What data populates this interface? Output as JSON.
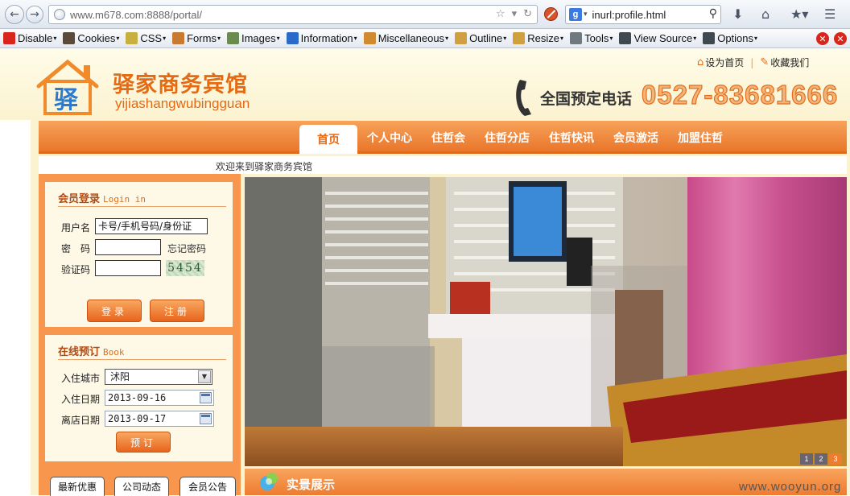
{
  "browser": {
    "url": "www.m678.com:8888/portal/",
    "search_engine_letter": "g",
    "search_query": "inurl:profile.html"
  },
  "devbar": {
    "items": [
      {
        "label": "Disable",
        "icon": "disable-icon",
        "color": "#d9261c"
      },
      {
        "label": "Cookies",
        "icon": "cookies-icon",
        "color": "#5a4a3a"
      },
      {
        "label": "CSS",
        "icon": "css-icon",
        "color": "#c8b040"
      },
      {
        "label": "Forms",
        "icon": "forms-icon",
        "color": "#c87a30"
      },
      {
        "label": "Images",
        "icon": "images-icon",
        "color": "#6a8a50"
      },
      {
        "label": "Information",
        "icon": "information-icon",
        "color": "#2a6ac8"
      },
      {
        "label": "Miscellaneous",
        "icon": "miscellaneous-icon",
        "color": "#d08a30"
      },
      {
        "label": "Outline",
        "icon": "outline-icon",
        "color": "#d0a040"
      },
      {
        "label": "Resize",
        "icon": "resize-icon",
        "color": "#d0a040"
      },
      {
        "label": "Tools",
        "icon": "tools-icon",
        "color": "#707880"
      },
      {
        "label": "View Source",
        "icon": "view-source-icon",
        "color": "#404850"
      },
      {
        "label": "Options",
        "icon": "options-icon",
        "color": "#404850"
      }
    ]
  },
  "header": {
    "logo_char": "驿",
    "brand_name": "驿家商务宾馆",
    "brand_pinyin": "yijiashangwubingguan",
    "set_home": "设为首页",
    "bookmark": "收藏我们",
    "phone_label": "全国预定电话",
    "phone_number": "0527-83681666"
  },
  "nav": {
    "items": [
      "首页",
      "个人中心",
      "住哲会",
      "住哲分店",
      "住哲快讯",
      "会员激活",
      "加盟住哲"
    ]
  },
  "welcome": "欢迎来到驿家商务宾馆",
  "login": {
    "title": "会员登录",
    "title_en": "Login in",
    "username_label": "用户名",
    "username_value": "卡号/手机号码/身份证",
    "password_label": "密　码",
    "forgot_label": "忘记密码",
    "captcha_label": "验证码",
    "captcha_value": "5454",
    "login_button": "登录",
    "register_button": "注册"
  },
  "booking": {
    "title": "在线预订",
    "title_en": "Book",
    "city_label": "入住城市",
    "city_value": "沭阳",
    "checkin_label": "入住日期",
    "checkin_value": "2013-09-16",
    "checkout_label": "离店日期",
    "checkout_value": "2013-09-17",
    "book_button": "预订"
  },
  "banner": {
    "slides": [
      "1",
      "2",
      "3"
    ],
    "active_slide": "3"
  },
  "tabs": [
    "最新优惠",
    "公司动态",
    "会员公告"
  ],
  "showcase": {
    "title": "实景展示"
  },
  "watermark": "www.wooyun.org",
  "colors": {
    "accent": "#e56a14",
    "nav_orange": "#ee7c30",
    "panel_bg": "#fef8e6"
  }
}
